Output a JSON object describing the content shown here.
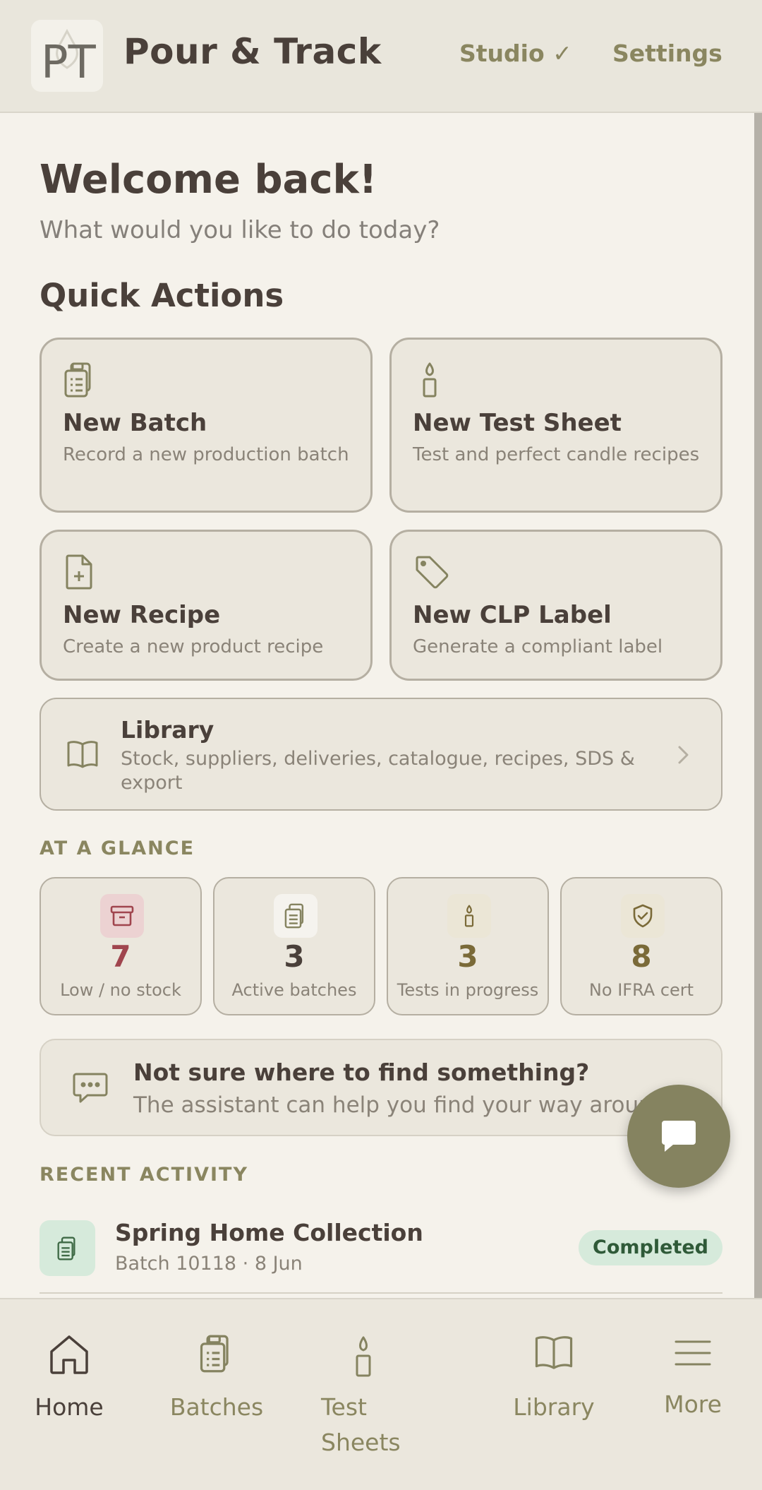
{
  "header": {
    "logo_text": "PT",
    "app_title": "Pour & Track",
    "studio_label": "Studio ✓",
    "settings_label": "Settings"
  },
  "welcome": {
    "title": "Welcome back!",
    "subtitle": "What would you like to do today?"
  },
  "quick_actions": {
    "title": "Quick Actions",
    "items": [
      {
        "title": "New Batch",
        "desc": "Record a new production batch",
        "icon": "clipboard-icon"
      },
      {
        "title": "New Test Sheet",
        "desc": "Test and perfect candle recipes",
        "icon": "candle-icon"
      },
      {
        "title": "New Recipe",
        "desc": "Create a new product recipe",
        "icon": "file-plus-icon"
      },
      {
        "title": "New CLP Label",
        "desc": "Generate a compliant label",
        "icon": "tag-icon"
      }
    ]
  },
  "library": {
    "title": "Library",
    "desc": "Stock, suppliers, deliveries, catalogue, recipes, SDS & export"
  },
  "glance": {
    "title": "AT A GLANCE",
    "stats": [
      {
        "value": "7",
        "label": "Low / no stock",
        "icon": "archive-icon",
        "color": "#a0454e",
        "bg": "#ecd2d2"
      },
      {
        "value": "3",
        "label": "Active batches",
        "icon": "clipboard-icon",
        "color": "#4a403a",
        "bg": "#f5f3ee"
      },
      {
        "value": "3",
        "label": "Tests in progress",
        "icon": "candle-icon",
        "color": "#7a6a38",
        "bg": "#ebe6d6"
      },
      {
        "value": "8",
        "label": "No IFRA cert",
        "icon": "shield-check-icon",
        "color": "#7a6a38",
        "bg": "#ebe6d6"
      }
    ]
  },
  "help": {
    "title": "Not sure where to find something?",
    "desc": "The assistant can help you find your way around."
  },
  "recent": {
    "title": "RECENT ACTIVITY",
    "items": [
      {
        "title": "Spring Home Collection",
        "meta": "Batch 10118 · 8 Jun",
        "status": "Completed"
      }
    ]
  },
  "bottom_nav": {
    "items": [
      {
        "label": "Home",
        "active": true
      },
      {
        "label": "Batches",
        "active": false
      },
      {
        "label": "Test Sheets",
        "active": false
      },
      {
        "label": "Library",
        "active": false
      },
      {
        "label": "More",
        "active": false
      }
    ]
  },
  "colors": {
    "accent": "#858360",
    "background": "#f5f2eb",
    "card": "#ebe7dd",
    "text": "#4a403a",
    "muted": "#8a8378",
    "danger": "#a0454e",
    "success_bg": "#d6eadb"
  }
}
